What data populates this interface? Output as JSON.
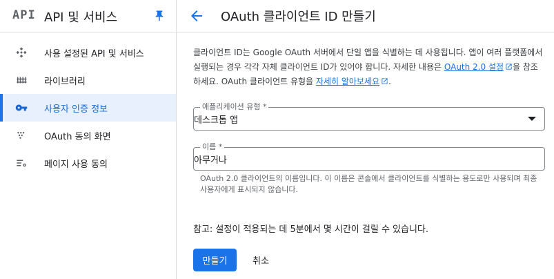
{
  "sidebar": {
    "logo": "API",
    "title": "API 및 서비스",
    "items": [
      {
        "label": "사용 설정된 API 및 서비스",
        "icon": "api-hub-icon",
        "active": false
      },
      {
        "label": "라이브러리",
        "icon": "library-icon",
        "active": false
      },
      {
        "label": "사용자 인증 정보",
        "icon": "key-icon",
        "active": true
      },
      {
        "label": "OAuth 동의 화면",
        "icon": "consent-dots-icon",
        "active": false
      },
      {
        "label": "페이지 사용 동의",
        "icon": "settings-list-icon",
        "active": false
      }
    ]
  },
  "header": {
    "title": "OAuth 클라이언트 ID 만들기"
  },
  "description": {
    "text_1": "클라이언트 ID는 Google OAuth 서버에서 단일 앱을 식별하는 데 사용됩니다. 앱이 여러 플랫폼에서 실행되는 경우 각각 자체 클라이언트 ID가 있어야 합니다. 자세한 내용은 ",
    "link_1": "OAuth 2.0 설정",
    "text_2": "을 참조하세요. OAuth 클라이언트 유형을 ",
    "link_2": "자세히 알아보세요",
    "text_3": "."
  },
  "form": {
    "app_type": {
      "label": "애플리케이션 유형 *",
      "value": "데스크톱 앱"
    },
    "name": {
      "label": "이름 *",
      "value": "아무거나"
    },
    "name_hint": "OAuth 2.0 클라이언트의 이름입니다. 이 이름은 콘솔에서 클라이언트를 식별하는 용도로만 사용되며 최종 사용자에게 표시되지 않습니다."
  },
  "note": "참고: 설정이 적용되는 데 5분에서 몇 시간이 걸릴 수 있습니다.",
  "buttons": {
    "create": "만들기",
    "cancel": "취소"
  },
  "colors": {
    "accent": "#1a73e8",
    "active_bg": "#e8f0fe"
  }
}
